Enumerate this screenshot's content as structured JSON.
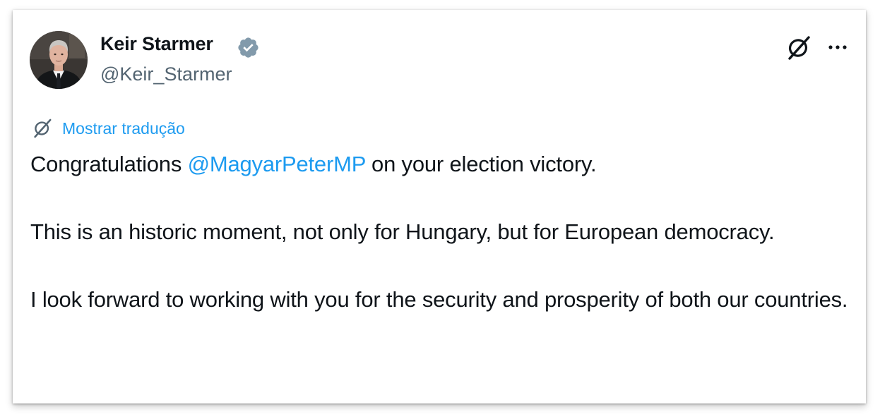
{
  "author": {
    "display_name": "Keir Starmer",
    "handle": "@Keir_Starmer",
    "verified": true,
    "avatar_icon": "profile-photo"
  },
  "actions": {
    "grok_icon": "grok-slash-icon",
    "more_icon": "ellipsis-icon"
  },
  "translate": {
    "icon": "grok-slash-icon",
    "label": "Mostrar tradução"
  },
  "tweet": {
    "p1_before": "Congratulations ",
    "p1_mention": "@MagyarPeterMP",
    "p1_after": " on your election victory.",
    "p2": "This is an historic moment, not only for Hungary, but for European democracy.",
    "p3": "I look forward to working with you for the security and prosperity of both our countries."
  },
  "colors": {
    "link": "#1d9bf0",
    "text": "#0f1419",
    "secondary": "#536471",
    "verified_badge": "#829aab"
  }
}
